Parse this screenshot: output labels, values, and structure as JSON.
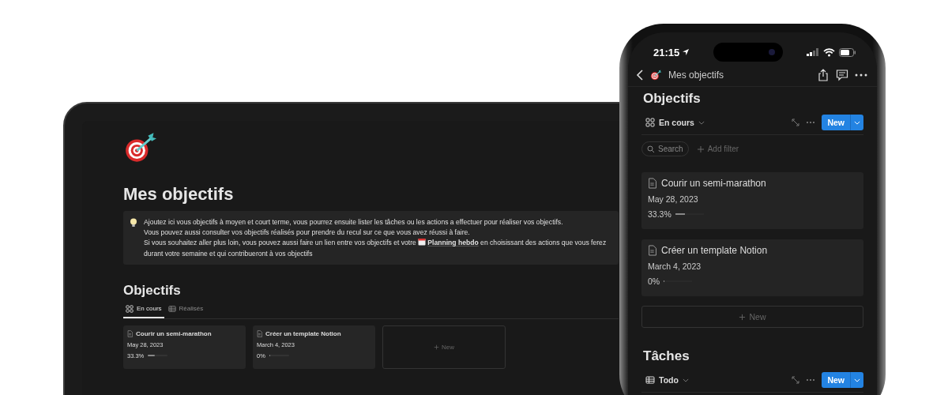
{
  "laptop": {
    "page_title": "Mes objectifs",
    "callout": {
      "paragraphs": [
        "Ajoutez ici vous objectifs à moyen et court terme, vous pourrez ensuite lister les tâches ou les actions a effectuer pour réaliser vos objectifs.",
        "Vous pouvez aussi consulter vos objectifs réalisés pour prendre du recul sur ce que vous avez réussi à faire."
      ],
      "last": {
        "before": "Si vous souhaitez aller plus loin, vous pouvez aussi faire un lien entre vos objectifs et votre ",
        "link": "Planning hebdo",
        "after": " en choisissant des actions que vous ferez durant votre semaine et qui contribueront à vos objectifs"
      }
    },
    "section_title": "Objectifs",
    "tabs": [
      {
        "label": "En cours",
        "kind": "gallery",
        "selected": true
      },
      {
        "label": "Réalisés",
        "kind": "table",
        "selected": false
      }
    ],
    "cards": [
      {
        "title": "Courir un semi-marathon",
        "date": "May 28, 2023",
        "progress": "33.3%",
        "level": 0.333
      },
      {
        "title": "Créer un template Notion",
        "date": "March 4, 2023",
        "progress": "0%",
        "level": 0
      }
    ],
    "new_card": "New"
  },
  "phone": {
    "time": "21:15",
    "nav_title": "Mes objectifs",
    "sections": [
      {
        "title": "Objectifs",
        "view": "En cours",
        "kind": "gallery",
        "new_button": "New",
        "search": "Search",
        "add_filter": "Add filter",
        "cards": [
          {
            "title": "Courir un semi-marathon",
            "date": "May 28, 2023",
            "progress": "33.3%",
            "level": 0.333
          },
          {
            "title": "Créer un template Notion",
            "date": "March 4, 2023",
            "progress": "0%",
            "level": 0
          }
        ],
        "new_card": "New"
      },
      {
        "title": "Tâches",
        "view": "Todo",
        "kind": "table",
        "new_button": "New"
      }
    ]
  }
}
